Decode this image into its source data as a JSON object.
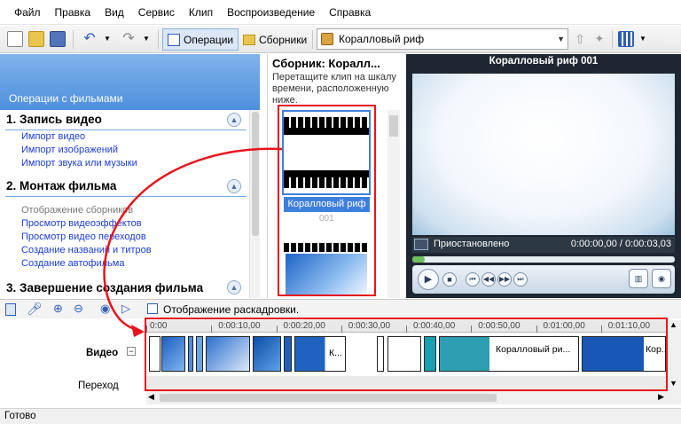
{
  "menu": [
    "Файл",
    "Правка",
    "Вид",
    "Сервис",
    "Клип",
    "Воспроизведение",
    "Справка"
  ],
  "toolbar": {
    "operations_label": "Операции",
    "collections_label": "Сборники",
    "collection_value": "Коралловый риф"
  },
  "tasks": {
    "header": "Операции с фильмами",
    "s1": {
      "title": "1. Запись видео",
      "links": [
        "Импорт видео",
        "Импорт изображений",
        "Импорт звука или музыки"
      ]
    },
    "s2": {
      "title": "2. Монтаж фильма",
      "links": [
        "Отображение сборников",
        "Просмотр видеоэффектов",
        "Просмотр видео переходов",
        "Создание названий и титров",
        "Создание автофильма"
      ]
    },
    "s3": {
      "title": "3. Завершение создания фильма"
    }
  },
  "collection": {
    "title": "Сборник: Коралл...",
    "desc": "Перетащите клип на шкалу времени, расположенную ниже.",
    "clip_label": "Коралловый риф",
    "clip_num": "001"
  },
  "preview": {
    "title": "Коралловый риф 001",
    "status": "Приостановлено",
    "time": "0:00:00,00 / 0:00:03,03"
  },
  "timeline": {
    "storyboard_label": "Отображение раскадровки.",
    "ticks": [
      "0:00",
      "0:00:10,00",
      "0:00:20,00",
      "0:00:30,00",
      "0:00:40,00",
      "0:00:50,00",
      "0:01:00,00",
      "0:01:10,00"
    ],
    "video_label": "Видео",
    "transition_label": "Переход",
    "clip_titles": [
      "К...",
      "Коралловый ри...",
      "Кор..."
    ]
  },
  "status": "Готово",
  "colors": {
    "annotation": "#e8141b",
    "link": "#1b3dd4",
    "selected": "#3f7fdc",
    "panel_header": "#4e8fdd",
    "preview_bg": "#1e2731"
  }
}
